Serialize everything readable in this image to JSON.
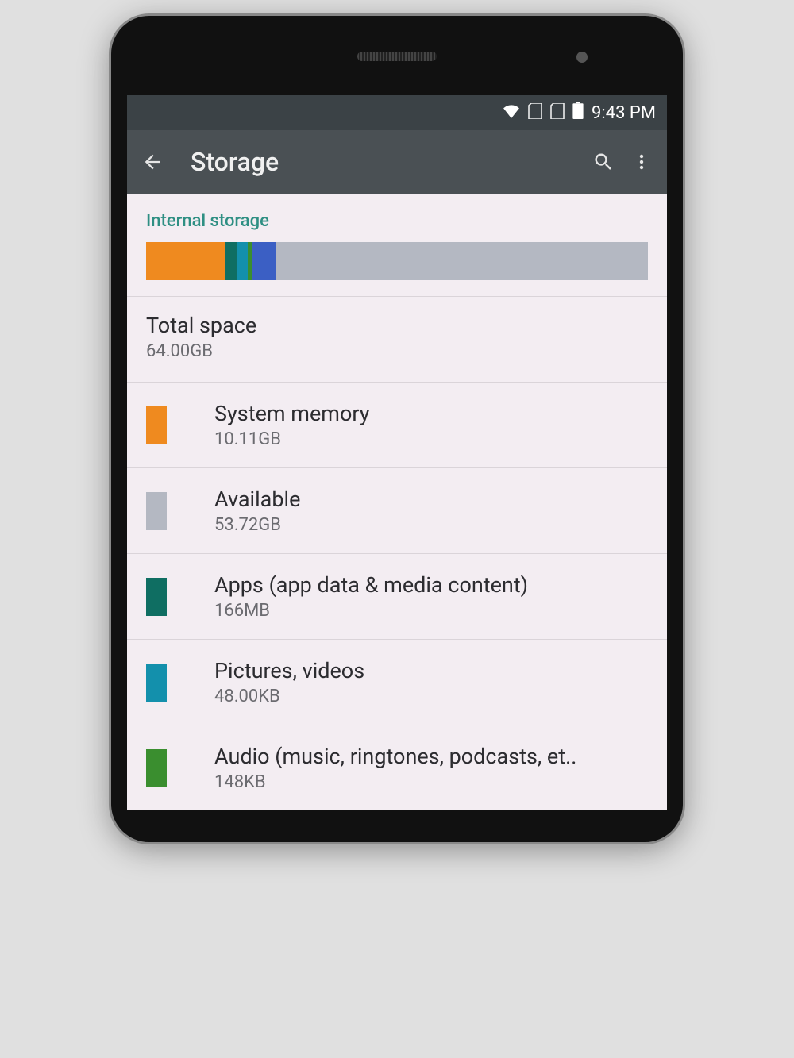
{
  "status": {
    "time": "9:43 PM"
  },
  "appbar": {
    "title": "Storage"
  },
  "section": {
    "header": "Internal storage"
  },
  "total": {
    "label": "Total space",
    "value": "64.00GB"
  },
  "bar_segments": [
    {
      "color": "#ef8a1f",
      "width": "15.8%"
    },
    {
      "color": "#0f6e62",
      "width": "2.4%"
    },
    {
      "color": "#1390ac",
      "width": "2.0%"
    },
    {
      "color": "#3a8e2f",
      "width": "1.0%"
    },
    {
      "color": "#3b5fc4",
      "width": "4.8%"
    },
    {
      "color": "#b4b8c2",
      "width": "74%"
    }
  ],
  "items": [
    {
      "name": "system-memory",
      "label": "System memory",
      "value": "10.11GB",
      "color": "#ef8a1f"
    },
    {
      "name": "available",
      "label": "Available",
      "value": "53.72GB",
      "color": "#b4b8c2"
    },
    {
      "name": "apps",
      "label": "Apps (app data & media content)",
      "value": "166MB",
      "color": "#0f6e62"
    },
    {
      "name": "pictures-videos",
      "label": "Pictures, videos",
      "value": "48.00KB",
      "color": "#1390ac"
    },
    {
      "name": "audio",
      "label": "Audio (music, ringtones, podcasts, et..",
      "value": "148KB",
      "color": "#3a8e2f"
    }
  ]
}
